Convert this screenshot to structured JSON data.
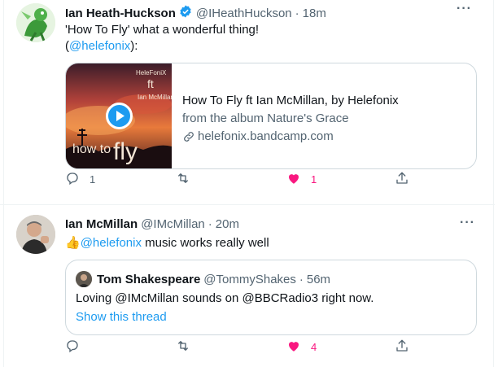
{
  "tweets": [
    {
      "name": "Ian Heath-Huckson",
      "handle": "@IHeathHuckson",
      "time": "18m",
      "text_line1": "'How To Fly'  what a wonderful thing!",
      "text_line2_open": "(",
      "text_line2_link": "@helefonix",
      "text_line2_close": "):",
      "card": {
        "title": "How To Fly ft Ian McMillan, by Helefonix",
        "description": "from the album Nature's Grace",
        "domain": "helefonix.bandcamp.com",
        "image_words": [
          "HeleFoniX",
          "ft",
          "Ian McMillan",
          "how to",
          "fly"
        ]
      },
      "replies": "1",
      "likes": "1"
    },
    {
      "name": "Ian McMillan",
      "handle": "@IMcMillan",
      "time": "20m",
      "emoji": "👍",
      "mention": "@helefonix",
      "text_rest": " music works really well",
      "quote": {
        "name": "Tom Shakespeare",
        "handle": "@TommyShakes",
        "time": "56m",
        "text": "Loving @IMcMillan sounds on @BBCRadio3 right now.",
        "show_thread": "Show this thread"
      },
      "likes": "4"
    }
  ],
  "ui": {
    "dot": "·",
    "more": "···"
  },
  "colors": {
    "link": "#1d9bf0",
    "like": "#f91880",
    "muted": "#536471",
    "verified": "#1d9bf0"
  },
  "icons": [
    "reply-icon",
    "retweet-icon",
    "like-icon",
    "share-icon",
    "verified-icon",
    "link-icon",
    "play-icon",
    "more-icon"
  ]
}
